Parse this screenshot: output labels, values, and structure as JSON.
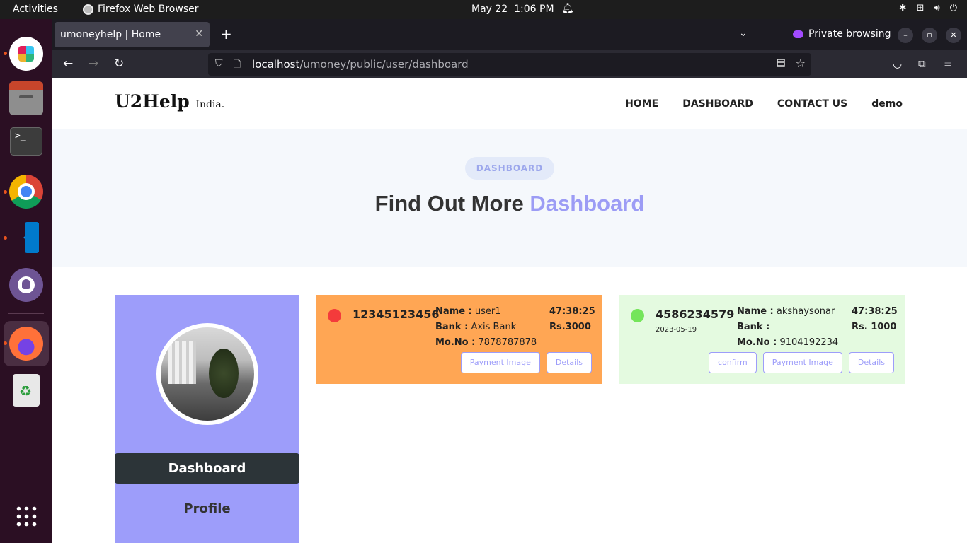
{
  "topbar": {
    "activities": "Activities",
    "app_name": "Firefox Web Browser",
    "date": "May 22",
    "time": "1:06 PM"
  },
  "browser": {
    "tab_title": "umoneyhelp | Home",
    "private_label": "Private browsing",
    "url_host": "localhost",
    "url_path": "/umoney/public/user/dashboard"
  },
  "site": {
    "logo_main": "U2Help",
    "logo_sub": "India.",
    "nav": [
      "HOME",
      "DASHBOARD",
      "CONTACT US",
      "demo"
    ]
  },
  "hero": {
    "pill": "DASHBOARD",
    "title_main": "Find Out More",
    "title_accent": "Dashboard",
    "accent_color": "#9c9cf5"
  },
  "sidebar": {
    "dashboard_label": "Dashboard",
    "profile_label": "Profile"
  },
  "cards": [
    {
      "status_color": "#f43b3b",
      "account": "12345123456",
      "date": "",
      "name_label": "Name :",
      "name": "user1",
      "bank_label": "Bank :",
      "bank": "Axis Bank",
      "mobile_label": "Mo.No :",
      "mobile": "7878787878",
      "time": "47:38:25",
      "amount": "Rs.3000",
      "buttons": [
        "Payment Image",
        "Details"
      ]
    },
    {
      "status_color": "#74e55a",
      "account": "4586234579",
      "date": "2023-05-19",
      "name_label": "Name :",
      "name": "akshaysonar",
      "bank_label": "Bank :",
      "bank": "",
      "mobile_label": "Mo.No :",
      "mobile": "9104192234",
      "time": "47:38:25",
      "amount": "Rs. 1000",
      "buttons": [
        "confirm",
        "Payment Image",
        "Details"
      ]
    }
  ]
}
